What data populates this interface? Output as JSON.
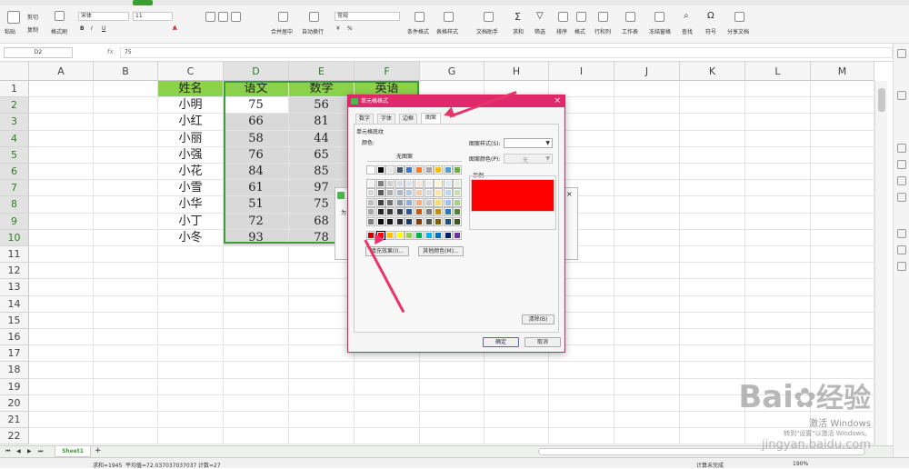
{
  "ribbon": {
    "paste": "粘贴",
    "cut": "剪切",
    "copy": "复制",
    "format_painter": "格式刷",
    "font_name": "宋体",
    "font_size": "11",
    "merge_center": "合并居中",
    "wrap": "自动换行",
    "number_format": "常规",
    "conditional_format": "条件格式",
    "cell_style": "表格样式",
    "doc_helper": "文档助手",
    "sum": "求和",
    "filter": "筛选",
    "sort": "排序",
    "format": "格式",
    "row_col": "行和列",
    "worksheet": "工作表",
    "freeze": "冻结窗格",
    "find": "查找",
    "symbol": "符号",
    "share": "分享文档"
  },
  "formula_bar": {
    "name_box": "D2",
    "fx": "fx",
    "value": "75"
  },
  "columns": [
    "A",
    "B",
    "C",
    "D",
    "E",
    "F",
    "G",
    "H",
    "I",
    "J",
    "K",
    "L",
    "M"
  ],
  "rows": [
    "1",
    "2",
    "3",
    "4",
    "5",
    "6",
    "7",
    "8",
    "9",
    "10",
    "11",
    "12",
    "13",
    "14",
    "15",
    "16",
    "17",
    "18",
    "19",
    "20",
    "21",
    "22"
  ],
  "table": {
    "header": [
      "姓名",
      "语文",
      "数学",
      "英语"
    ],
    "names": [
      "小明",
      "小红",
      "小丽",
      "小强",
      "小花",
      "小雪",
      "小华",
      "小丁",
      "小冬"
    ],
    "yuwen": [
      "75",
      "66",
      "58",
      "76",
      "84",
      "61",
      "51",
      "72",
      "93"
    ],
    "shuxue": [
      "56",
      "81",
      "44",
      "65",
      "85",
      "97",
      "75",
      "68",
      "78"
    ]
  },
  "sheet_tab": "Sheet1",
  "status": {
    "sum": "求和=1945",
    "avg": "平均值=72.037037037037",
    "count": "计数=27",
    "mode": "计算未完成",
    "zoom": "190%"
  },
  "dialog": {
    "title": "单元格格式",
    "close": "×",
    "tabs": [
      "数字",
      "字体",
      "边框",
      "图案"
    ],
    "section": "单元格底纹",
    "color_label": "颜色:",
    "no_pattern": "无图案",
    "pattern_style_label": "图案样式(S):",
    "pattern_color_label": "图案颜色(P):",
    "pattern_color_value": "无",
    "sample_label": "示例",
    "fill_effects": "填充效果(I)...",
    "more_colors": "其他颜色(M)...",
    "clear": "清除(B)",
    "ok": "确定",
    "cancel": "取消",
    "preview_color": "#ff0000",
    "swatch_rows": [
      [
        "#ffffff",
        "#000000",
        "#e7e6e6",
        "#44546a",
        "#4472c4",
        "#ed7d31",
        "#a5a5a5",
        "#ffc000",
        "#5b9bd5",
        "#70ad47"
      ],
      [
        "#f2f2f2",
        "#7f7f7f",
        "#d0cece",
        "#d6dce4",
        "#dae3f3",
        "#fbe5d6",
        "#ededed",
        "#fff2cc",
        "#deebf7",
        "#e2f0d9"
      ],
      [
        "#d9d9d9",
        "#595959",
        "#aeabab",
        "#adb9ca",
        "#b4c7e7",
        "#f8cbad",
        "#dbdbdb",
        "#ffe699",
        "#bdd7ee",
        "#c5e0b4"
      ],
      [
        "#bfbfbf",
        "#404040",
        "#757070",
        "#8497b0",
        "#8faadc",
        "#f4b183",
        "#c9c9c9",
        "#ffd966",
        "#9dc3e6",
        "#a9d18e"
      ],
      [
        "#a6a6a6",
        "#262626",
        "#3b3838",
        "#333f50",
        "#2f5597",
        "#c55a11",
        "#7b7b7b",
        "#bf9000",
        "#2e75b6",
        "#548235"
      ],
      [
        "#7f7f7f",
        "#0d0d0d",
        "#171616",
        "#222a35",
        "#203864",
        "#843c0c",
        "#525252",
        "#7f6000",
        "#1f4e79",
        "#385723"
      ],
      [
        "#c00000",
        "#ff0000",
        "#ffc000",
        "#ffff00",
        "#92d050",
        "#00b050",
        "#00b0f0",
        "#0070c0",
        "#002060",
        "#7030a0"
      ]
    ]
  },
  "ghost_dialog_label": "为",
  "watermark": {
    "brand": "Bai",
    "brand_cn": "经验",
    "activate1": "激活 Windows",
    "activate2": "转到\"设置\"以激活 Windows。",
    "site": "jingyan.baidu.com"
  }
}
